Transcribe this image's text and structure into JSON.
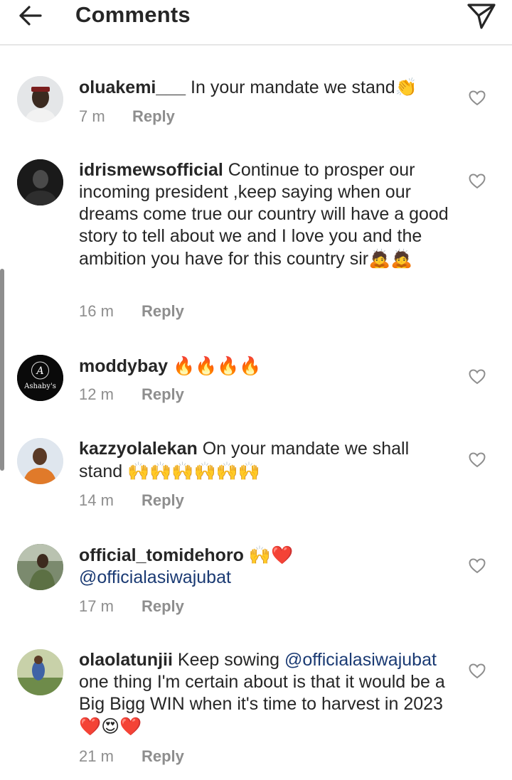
{
  "header": {
    "title": "Comments",
    "back_icon": "arrow-left-icon",
    "share_icon": "paper-plane-icon"
  },
  "comments": [
    {
      "username": "oluakemi___",
      "text": " In your mandate we stand",
      "emoji": "👏",
      "time": "7 m",
      "reply": "Reply"
    },
    {
      "username": "idrismewsofficial",
      "text": " Continue to prosper our incoming president ,keep saying when our dreams come true our country will have a good story to tell about we and I love you and the ambition you have for this country sir",
      "emoji": "🙇🙇",
      "time": "16 m",
      "reply": "Reply"
    },
    {
      "username": "moddybay",
      "text": " ",
      "emoji": "🔥🔥🔥🔥",
      "time": "12 m",
      "reply": "Reply",
      "avatar_text": "Ashaby's",
      "avatar_monogram": "A"
    },
    {
      "username": "kazzyolalekan",
      "text": " On your mandate we shall stand ",
      "emoji": "🙌🙌🙌🙌🙌🙌",
      "time": "14 m",
      "reply": "Reply"
    },
    {
      "username": "official_tomidehoro",
      "text": " ",
      "emoji": "🙌❤️",
      "mention": "@officialasiwajubat",
      "time": "17 m",
      "reply": "Reply"
    },
    {
      "username": "olaolatunjii",
      "text_before": " Keep sowing ",
      "mention": "@officialasiwajubat",
      "text_after": " one thing I'm certain about is that it would be a Big Bigg WIN when it's time to harvest in 2023",
      "emoji": "❤️😍❤️",
      "time": "21 m",
      "reply": "Reply"
    }
  ],
  "colors": {
    "text": "#262626",
    "secondary": "#8e8e8e",
    "mention": "#1a3a73",
    "divider": "#e6e6e6"
  }
}
